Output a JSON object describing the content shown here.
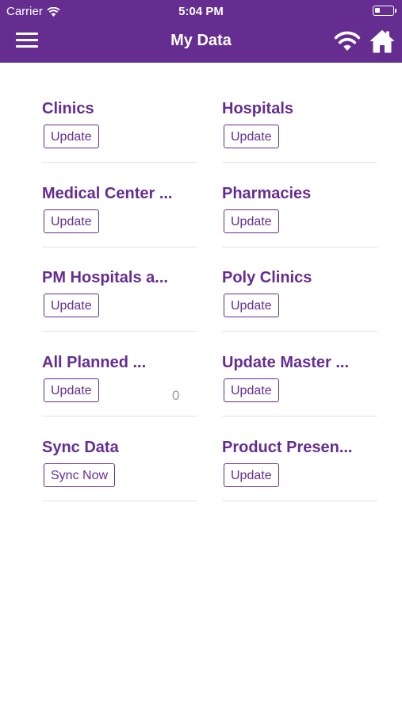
{
  "status_bar": {
    "carrier": "Carrier",
    "time": "5:04 PM"
  },
  "nav": {
    "title": "My Data"
  },
  "tiles": [
    {
      "title": "Clinics",
      "button": "Update"
    },
    {
      "title": "Hospitals",
      "button": "Update"
    },
    {
      "title": "Medical Center ...",
      "button": "Update"
    },
    {
      "title": "Pharmacies",
      "button": "Update"
    },
    {
      "title": "PM Hospitals a...",
      "button": "Update"
    },
    {
      "title": "Poly Clinics",
      "button": "Update"
    },
    {
      "title": "All Planned ...",
      "button": "Update",
      "count": "0"
    },
    {
      "title": "Update Master ...",
      "button": "Update"
    },
    {
      "title": "Sync Data",
      "button": "Sync Now"
    },
    {
      "title": "Product Presen...",
      "button": "Update"
    }
  ],
  "colors": {
    "brand": "#652d90",
    "divider": "#e3e3e3",
    "count": "#9a9a9a"
  },
  "icons": {
    "menu": "hamburger-icon",
    "wifi": "wifi-icon",
    "home": "home-icon",
    "battery": "battery-icon"
  }
}
